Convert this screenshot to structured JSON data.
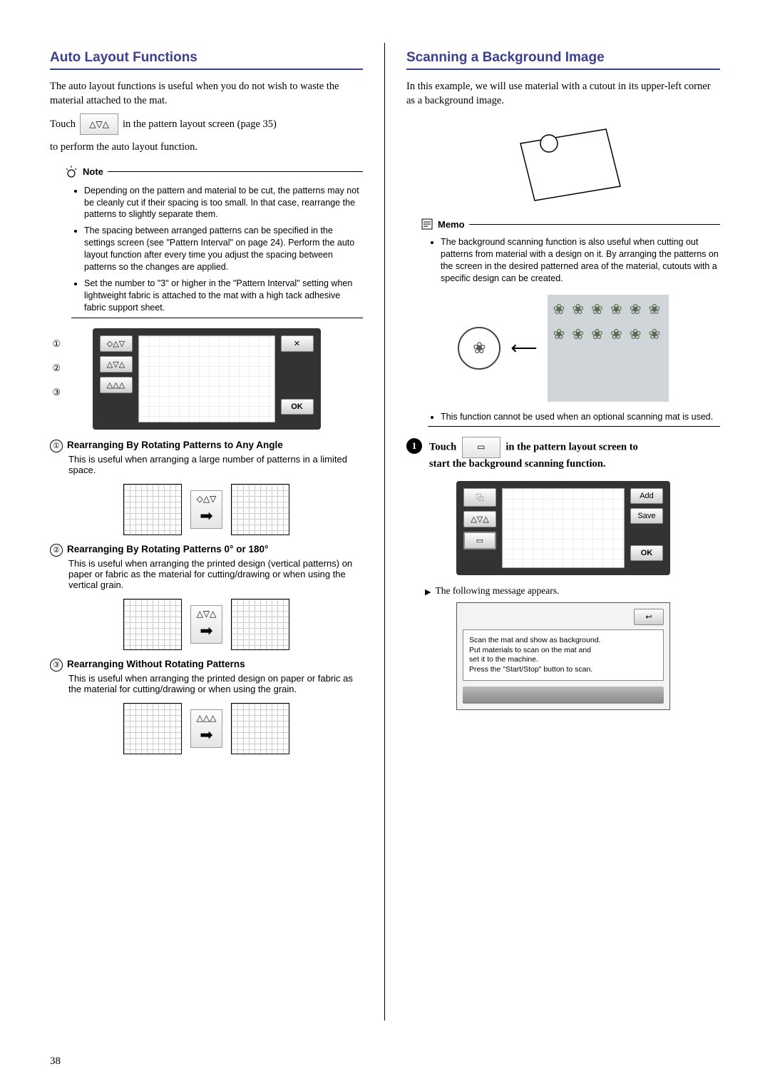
{
  "page_number": "38",
  "left": {
    "heading": "Auto Layout Functions",
    "intro": "The auto layout functions is useful when you do not wish to waste the material attached to the mat.",
    "touch_pre": "Touch",
    "touch_icon": "△▽△",
    "touch_post": "in the pattern layout screen (page 35)",
    "touch_line2": "to perform the auto layout function.",
    "note_label": "Note",
    "note_items": [
      "Depending on the pattern and material to be cut, the patterns may not be cleanly cut if their spacing is too small. In that case, rearrange the patterns to slightly separate them.",
      "The spacing between arranged patterns can be specified in the settings screen (see \"Pattern Interval\" on page 24). Perform the auto layout function after every time you adjust the spacing between patterns so the changes are applied.",
      "Set the number to \"3\" or higher in the \"Pattern Interval\" setting when lightweight fabric is attached to the mat with a high tack adhesive fabric support sheet."
    ],
    "screen_close": "✕",
    "screen_ok": "OK",
    "markers": {
      "m1": "①",
      "m2": "②",
      "m3": "③"
    },
    "side_icons": {
      "a": "◇△▽",
      "b": "△▽△",
      "c": "△△△"
    },
    "def1_title": "Rearranging By Rotating Patterns to Any Angle",
    "def1_desc": "This is useful when arranging a large number of patterns in a limited space.",
    "def1_icon": "◇△▽",
    "def2_title": "Rearranging By Rotating Patterns 0° or 180°",
    "def2_desc": "This is useful when arranging the printed design (vertical patterns) on paper or fabric as the material for cutting/drawing or when using the vertical grain.",
    "def2_icon": "△▽△",
    "def3_title": "Rearranging Without Rotating Patterns",
    "def3_desc": "This is useful when arranging the printed design on paper or fabric as the material for cutting/drawing or when using the grain.",
    "def3_icon": "△△△"
  },
  "right": {
    "heading": "Scanning a Background Image",
    "intro": "In this example, we will use material with a cutout in its upper-left corner as a background image.",
    "memo_label": "Memo",
    "memo_items": [
      "The background scanning function is also useful when cutting out patterns from material with a design on it. By arranging the patterns on the screen in the desired patterned area of the material, cutouts with a specific design can be created."
    ],
    "memo_item2": "This function cannot be used when an optional scanning mat is used.",
    "arrow_long": "⟵",
    "step1_pre": "Touch",
    "step1_icon": "▭",
    "step1_mid": "in the pattern layout screen to",
    "step1_line2": "start the background scanning function.",
    "screen_add": "Add",
    "screen_save": "Save",
    "screen_ok": "OK",
    "screen_btn1": "⿻",
    "screen_btn2": "△▽△",
    "screen_btn3": "▭",
    "result_text": "The following message appears.",
    "back_icon": "↩",
    "msg_line1": "Scan the mat and show as background.",
    "msg_line2": "Put materials to scan on the mat and",
    "msg_line3": "set it to the machine.",
    "msg_line4": "Press the \"Start/Stop\" button to scan."
  }
}
